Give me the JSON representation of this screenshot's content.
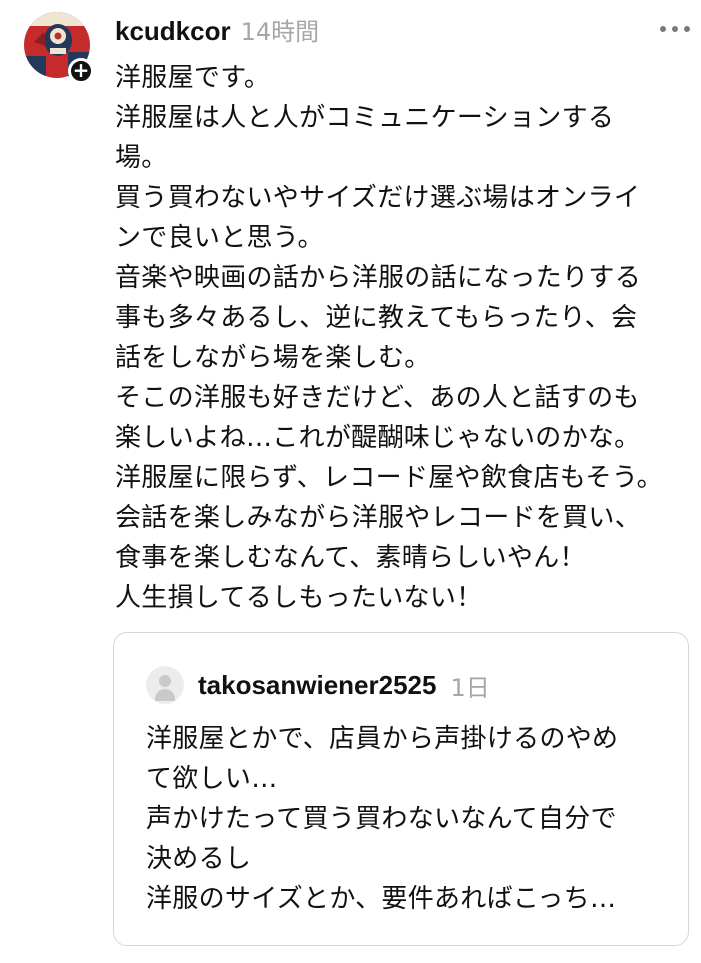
{
  "post": {
    "username": "kcudkcor",
    "time": "14時間",
    "lines": [
      "洋服屋です。",
      "洋服屋は人と人がコミュニケーションする",
      "場。",
      "買う買わないやサイズだけ選ぶ場はオンライ",
      "ンで良いと思う。",
      "音楽や映画の話から洋服の話になったりする",
      "事も多々あるし、逆に教えてもらったり、会",
      "話をしながら場を楽しむ。",
      "そこの洋服も好きだけど、あの人と話すのも",
      "楽しいよね…これが醍醐味じゃないのかな。",
      "洋服屋に限らず、レコード屋や飲食店もそう。",
      "会話を楽しみながら洋服やレコードを買い、",
      "食事を楽しむなんて、素晴らしいやん！",
      "人生損してるしもったいない！"
    ],
    "icons": {
      "avatar": "avatar-image",
      "follow": "plus-icon",
      "menu": "more-dots-icon"
    }
  },
  "quoted_post": {
    "username": "takosanwiener2525",
    "time": "1日",
    "lines": [
      "洋服屋とかで、店員から声掛けるのやめ",
      "て欲しい…",
      "声かけたって買う買わないなんて自分で",
      "決めるし",
      "洋服のサイズとか、要件あればこっち…"
    ],
    "icons": {
      "avatar": "default-avatar-icon"
    }
  },
  "colors": {
    "text": "#111111",
    "muted": "#a6a6a6",
    "border": "#d6d6d6",
    "avatar_red": "#c62b2b",
    "avatar_blue": "#23395b"
  }
}
